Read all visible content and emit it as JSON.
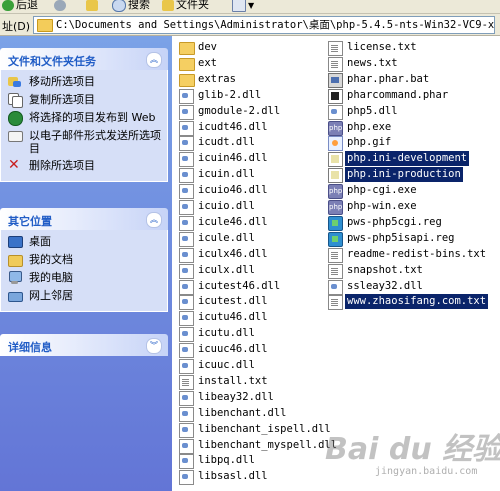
{
  "toolbar": {
    "back_label": "后退",
    "search_label": "搜索",
    "folders_label": "文件夹"
  },
  "address": {
    "label": "址(D)",
    "path": "C:\\Documents and Settings\\Administrator\\桌面\\php-5.4.5-nts-Win32-VC9-x86"
  },
  "file_tasks": {
    "title": "文件和文件夹任务",
    "items": [
      "移动所选项目",
      "复制所选项目",
      "将选择的项目发布到 Web",
      "以电子邮件形式发送所选项目",
      "删除所选项目"
    ]
  },
  "other_places": {
    "title": "其它位置",
    "items": [
      "桌面",
      "我的文档",
      "我的电脑",
      "网上邻居"
    ]
  },
  "details": {
    "title": "详细信息"
  },
  "files_col1": [
    {
      "name": "dev",
      "type": "folder"
    },
    {
      "name": "ext",
      "type": "folder"
    },
    {
      "name": "extras",
      "type": "folder"
    },
    {
      "name": "glib-2.dll",
      "type": "dll"
    },
    {
      "name": "gmodule-2.dll",
      "type": "dll"
    },
    {
      "name": "icudt46.dll",
      "type": "dll"
    },
    {
      "name": "icudt.dll",
      "type": "dll"
    },
    {
      "name": "icuin46.dll",
      "type": "dll"
    },
    {
      "name": "icuin.dll",
      "type": "dll"
    },
    {
      "name": "icuio46.dll",
      "type": "dll"
    },
    {
      "name": "icuio.dll",
      "type": "dll"
    },
    {
      "name": "icule46.dll",
      "type": "dll"
    },
    {
      "name": "icule.dll",
      "type": "dll"
    },
    {
      "name": "iculx46.dll",
      "type": "dll"
    },
    {
      "name": "iculx.dll",
      "type": "dll"
    },
    {
      "name": "icutest46.dll",
      "type": "dll"
    },
    {
      "name": "icutest.dll",
      "type": "dll"
    },
    {
      "name": "icutu46.dll",
      "type": "dll"
    },
    {
      "name": "icutu.dll",
      "type": "dll"
    },
    {
      "name": "icuuc46.dll",
      "type": "dll"
    },
    {
      "name": "icuuc.dll",
      "type": "dll"
    },
    {
      "name": "install.txt",
      "type": "txt"
    },
    {
      "name": "libeay32.dll",
      "type": "dll"
    },
    {
      "name": "libenchant.dll",
      "type": "dll"
    },
    {
      "name": "libenchant_ispell.dll",
      "type": "dll"
    },
    {
      "name": "libenchant_myspell.dll",
      "type": "dll"
    },
    {
      "name": "libpq.dll",
      "type": "dll"
    },
    {
      "name": "libsasl.dll",
      "type": "dll"
    }
  ],
  "files_col2": [
    {
      "name": "license.txt",
      "type": "txt"
    },
    {
      "name": "news.txt",
      "type": "txt"
    },
    {
      "name": "phar.phar.bat",
      "type": "bat"
    },
    {
      "name": "pharcommand.phar",
      "type": "cmd"
    },
    {
      "name": "php5.dll",
      "type": "dll"
    },
    {
      "name": "php.exe",
      "type": "php"
    },
    {
      "name": "php.gif",
      "type": "gif"
    },
    {
      "name": "php.ini-development",
      "type": "ini",
      "selected": true
    },
    {
      "name": "php.ini-production",
      "type": "ini",
      "selected": true
    },
    {
      "name": "php-cgi.exe",
      "type": "php"
    },
    {
      "name": "php-win.exe",
      "type": "php"
    },
    {
      "name": "pws-php5cgi.reg",
      "type": "reg"
    },
    {
      "name": "pws-php5isapi.reg",
      "type": "reg"
    },
    {
      "name": "readme-redist-bins.txt",
      "type": "txt"
    },
    {
      "name": "snapshot.txt",
      "type": "txt"
    },
    {
      "name": "ssleay32.dll",
      "type": "dll"
    },
    {
      "name": "www.zhaosifang.com.txt",
      "type": "txt",
      "selected": true
    }
  ],
  "watermark": {
    "logo": "Bai du 经验",
    "sub": "jingyan.baidu.com"
  },
  "colors": {
    "selection": "#0a246a",
    "panel_header": "#215dc6",
    "left_pane": "#6c8fd6"
  }
}
